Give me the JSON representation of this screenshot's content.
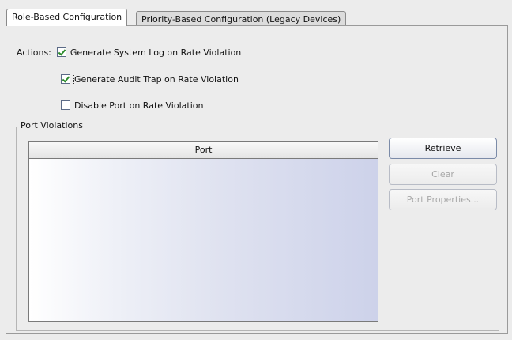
{
  "tabs": [
    {
      "label": "Role-Based Configuration",
      "active": true
    },
    {
      "label": "Priority-Based Configuration (Legacy Devices)",
      "active": false
    }
  ],
  "actions": {
    "label": "Actions:",
    "options": [
      {
        "label": "Generate System Log on Rate Violation",
        "checked": true
      },
      {
        "label": "Generate Audit Trap on Rate Violation",
        "checked": true,
        "focused": true
      },
      {
        "label": "Disable Port on Rate Violation",
        "checked": false
      }
    ]
  },
  "port_violations": {
    "title": "Port Violations",
    "table": {
      "columns": [
        "Port"
      ],
      "rows": []
    },
    "buttons": [
      {
        "label": "Retrieve",
        "enabled": true
      },
      {
        "label": "Clear",
        "enabled": false
      },
      {
        "label": "Port Properties...",
        "enabled": false
      }
    ]
  }
}
